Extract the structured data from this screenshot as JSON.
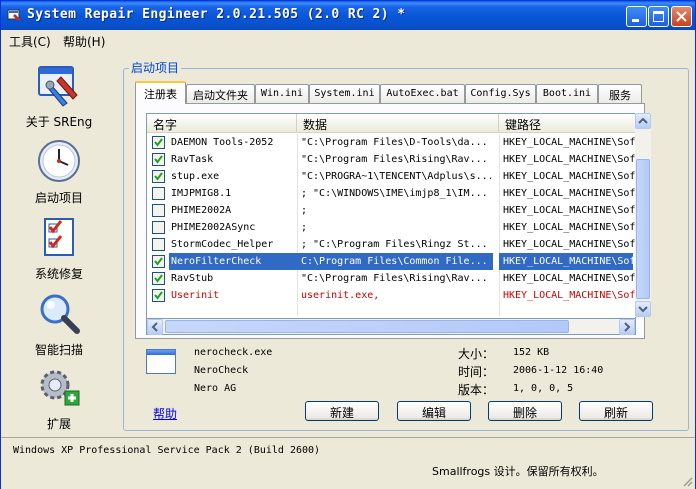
{
  "window": {
    "title": "System Repair Engineer 2.0.21.505 (2.0 RC 2) *"
  },
  "menu": [
    "工具(C)",
    "帮助(H)"
  ],
  "sidebar": {
    "items": [
      {
        "label": "关于 SREng",
        "icon": "about-sreng-icon"
      },
      {
        "label": "启动项目",
        "icon": "clock-icon"
      },
      {
        "label": "系统修复",
        "icon": "checklist-icon"
      },
      {
        "label": "智能扫描",
        "icon": "magnifier-icon"
      },
      {
        "label": "扩展",
        "icon": "gears-plus-icon"
      }
    ]
  },
  "group_title": "启动项目",
  "tabs": [
    {
      "label": "注册表",
      "active": true
    },
    {
      "label": "启动文件夹"
    },
    {
      "label": "Win.ini"
    },
    {
      "label": "System.ini"
    },
    {
      "label": "AutoExec.bat"
    },
    {
      "label": "Config.Sys"
    },
    {
      "label": "Boot.ini"
    },
    {
      "label": "服务"
    }
  ],
  "list": {
    "headers": [
      "名字",
      "数据",
      "键路径"
    ],
    "rows": [
      {
        "checked": true,
        "name": "DAEMON Tools-2052",
        "data": "\"C:\\Program Files\\D-Tools\\da...",
        "path": "HKEY_LOCAL_MACHINE\\Sof"
      },
      {
        "checked": true,
        "name": "RavTask",
        "data": "\"C:\\Program Files\\Rising\\Rav...",
        "path": "HKEY_LOCAL_MACHINE\\Sof"
      },
      {
        "checked": true,
        "name": "stup.exe",
        "data": "\"C:\\PROGRA~1\\TENCENT\\Adplus\\s...",
        "path": "HKEY_LOCAL_MACHINE\\Sof"
      },
      {
        "checked": false,
        "name": "IMJPMIG8.1",
        "data": "; \"C:\\WINDOWS\\IME\\imjp8_1\\IM...",
        "path": "HKEY_LOCAL_MACHINE\\Sof"
      },
      {
        "checked": false,
        "name": "PHIME2002A",
        "data": ";",
        "path": "HKEY_LOCAL_MACHINE\\Sof"
      },
      {
        "checked": false,
        "name": "PHIME2002ASync",
        "data": ";",
        "path": "HKEY_LOCAL_MACHINE\\Sof"
      },
      {
        "checked": false,
        "name": "StormCodec_Helper",
        "data": "; \"C:\\Program Files\\Ringz St...",
        "path": "HKEY_LOCAL_MACHINE\\Sof"
      },
      {
        "checked": true,
        "name": "NeroFilterCheck",
        "data": "C:\\Program Files\\Common File...",
        "path": "HKEY_LOCAL_MACHINE\\Sof",
        "selected": true
      },
      {
        "checked": true,
        "name": "RavStub",
        "data": "\"C:\\Program Files\\Rising\\Rav...",
        "path": "HKEY_LOCAL_MACHINE\\Sof"
      },
      {
        "checked": true,
        "name": "Userinit",
        "data": "userinit.exe,",
        "path": "HKEY_LOCAL_MACHINE\\Sof",
        "warning": true
      }
    ]
  },
  "details": {
    "file": "nerocheck.exe",
    "product": "NeroCheck",
    "company": "Nero AG",
    "size_label": "大小：",
    "size": "152 KB",
    "time_label": "时间：",
    "time": "2006-1-12 16:40",
    "version_label": "版本：",
    "version": "1, 0, 0, 5"
  },
  "help_link": "帮助",
  "buttons": {
    "new": "新建",
    "edit": "编辑",
    "delete": "删除",
    "refresh": "刷新"
  },
  "status": {
    "os": "Windows XP Professional Service Pack 2 (Build 2600)",
    "copyright": "Smallfrogs 设计。保留所有权利。"
  },
  "colors": {
    "titlebar": "#0756d8",
    "selection": "#316ac5",
    "warning_text": "#d00000",
    "group_title": "#0046d5",
    "link": "#0000ff"
  }
}
